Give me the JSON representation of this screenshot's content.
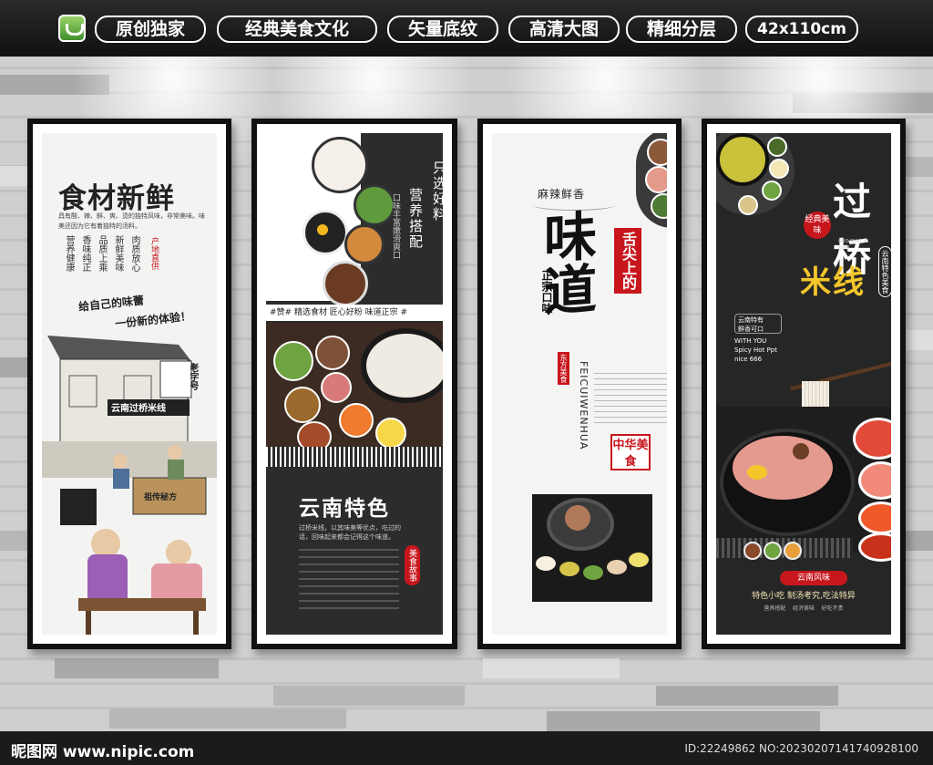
{
  "header": {
    "tags": [
      "原创独家",
      "经典美食文化",
      "矢量底纹",
      "高清大图",
      "精细分层",
      "42x110cm"
    ]
  },
  "panel1": {
    "title": "食材新鲜",
    "desc": "具有酸、辣、鲜、爽、烫的独特风味，非常美味。味美还因为它有着独特的汤料。",
    "cols": [
      "营养健康",
      "香味纯正",
      "品质上乘",
      "新鲜美味",
      "肉质放心"
    ],
    "stamp": "产地直供",
    "slogan1": "给自己的味蕾",
    "slogan2": "一份新的体验！",
    "shop_sign": "云南过桥米线",
    "shop_side": "老字号",
    "inner_sign": "祖传秘方"
  },
  "panel2": {
    "v1": "只选好料",
    "v2": "营养搭配",
    "v3": "口味丰富嫩滑爽口",
    "strip": "#赞# 精选食材 匠心好粉 味道正宗 #",
    "title": "云南特色",
    "body": "过桥米线，以其味美等优点，吃过的话，回味起来都会记得这个味道。",
    "tag": "美食故事"
  },
  "panel3": {
    "top": "麻辣鲜香",
    "big": "味道",
    "side": "舌尖上的",
    "sub": "正宗口味",
    "east": "东方美食",
    "pinyin": "FEICUIWENHUA",
    "seal": "中华美食"
  },
  "panel4": {
    "title1": "过桥",
    "title2": "米线",
    "badge": "经典美味",
    "pinyin": "GUO QIAO MI XIAN",
    "vert": "云南特色美食",
    "tag1": "云南特有",
    "tag2": "鲜香可口",
    "en1": "WITH YOU",
    "en2": "Spicy Hot Ppt",
    "en3": "nice 666",
    "footer_title": "云南风味",
    "footer_line": "特色小吃 制汤考究,吃法特异",
    "footer_small": "营养搭配    经济美味    好吃不贵"
  },
  "footer": {
    "site": "昵图网 www.nipic.com",
    "id": "ID:22249862 NO:20230207141740928100"
  },
  "colors": {
    "accent_red": "#c8161d",
    "panel_dark": "#2b2b2b",
    "frame": "#111111"
  }
}
